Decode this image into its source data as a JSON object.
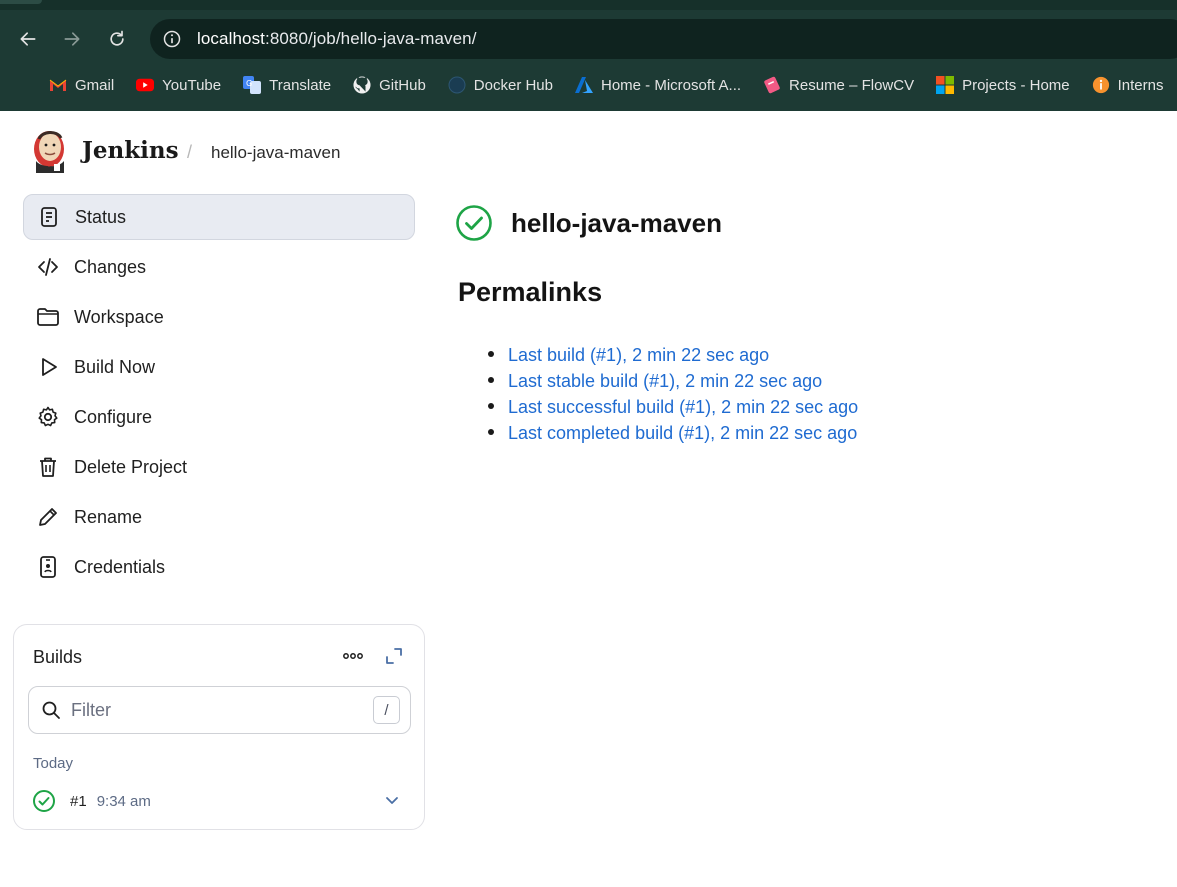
{
  "browser": {
    "url_host": "localhost",
    "url_rest": ":8080/job/hello-java-maven/",
    "bookmarks": [
      {
        "label": "Gmail",
        "icon": "gmail-icon"
      },
      {
        "label": "YouTube",
        "icon": "youtube-icon"
      },
      {
        "label": "Translate",
        "icon": "translate-icon"
      },
      {
        "label": "GitHub",
        "icon": "github-icon"
      },
      {
        "label": "Docker Hub",
        "icon": "docker-icon"
      },
      {
        "label": "Home - Microsoft A...",
        "icon": "azure-icon"
      },
      {
        "label": "Resume – FlowCV",
        "icon": "flowcv-icon"
      },
      {
        "label": "Projects - Home",
        "icon": "microsoft-icon"
      },
      {
        "label": "Interns",
        "icon": "interns-icon"
      }
    ]
  },
  "header": {
    "brand": "Jenkins",
    "separator": "/",
    "breadcrumb": "hello-java-maven"
  },
  "sidebar": {
    "items": [
      {
        "label": "Status",
        "icon": "status-icon",
        "active": true
      },
      {
        "label": "Changes",
        "icon": "code-icon"
      },
      {
        "label": "Workspace",
        "icon": "folder-icon"
      },
      {
        "label": "Build Now",
        "icon": "play-icon"
      },
      {
        "label": "Configure",
        "icon": "gear-icon"
      },
      {
        "label": "Delete Project",
        "icon": "trash-icon"
      },
      {
        "label": "Rename",
        "icon": "pencil-icon"
      },
      {
        "label": "Credentials",
        "icon": "credentials-icon"
      }
    ]
  },
  "builds": {
    "title": "Builds",
    "filter_placeholder": "Filter",
    "shortcut": "/",
    "day": "Today",
    "items": [
      {
        "number": "#1",
        "time": "9:34 am",
        "status": "success"
      }
    ]
  },
  "main": {
    "job_name": "hello-java-maven",
    "permalinks_heading": "Permalinks",
    "permalinks": [
      "Last build (#1), 2 min 22 sec ago",
      "Last stable build (#1), 2 min 22 sec ago",
      "Last successful build (#1), 2 min 22 sec ago",
      "Last completed build (#1), 2 min 22 sec ago"
    ]
  },
  "colors": {
    "chrome_bg": "#1d3a34",
    "link": "#1f6bd1",
    "success": "#1ea446",
    "active_nav_bg": "#e8ebf2"
  }
}
